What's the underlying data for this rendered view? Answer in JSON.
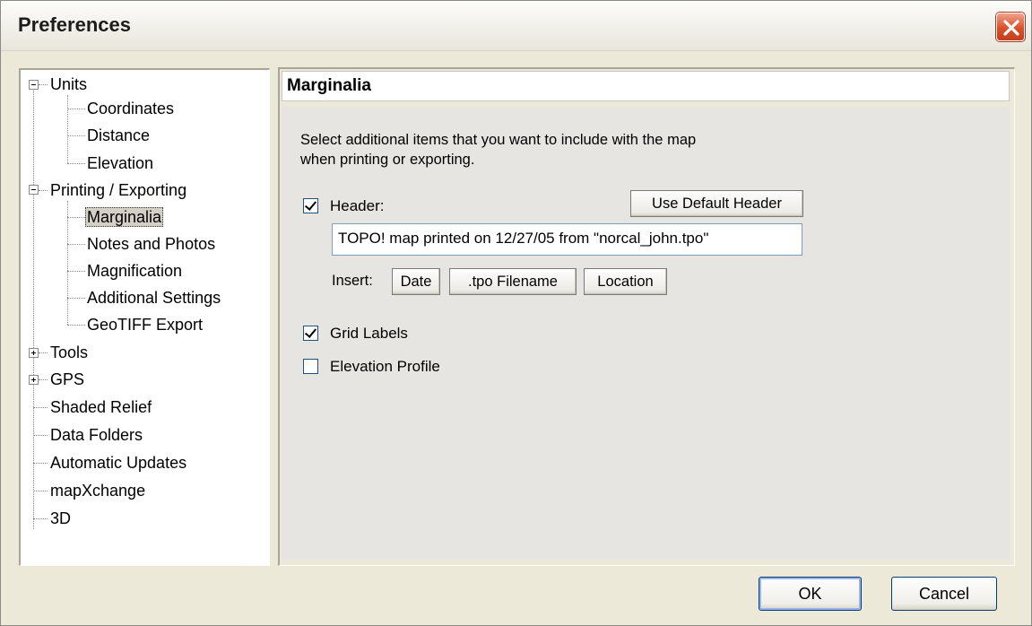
{
  "window": {
    "title": "Preferences"
  },
  "tree": {
    "units": "Units",
    "coordinates": "Coordinates",
    "distance": "Distance",
    "elevation": "Elevation",
    "printing": "Printing / Exporting",
    "marginalia": "Marginalia",
    "notes": "Notes and Photos",
    "magnification": "Magnification",
    "additional": "Additional Settings",
    "geotiff": "GeoTIFF Export",
    "tools": "Tools",
    "gps": "GPS",
    "shaded": "Shaded Relief",
    "datafolders": "Data Folders",
    "updates": "Automatic Updates",
    "mapxchange": "mapXchange",
    "threed": "3D"
  },
  "panel": {
    "title": "Marginalia",
    "description_line1": "Select additional items that you want to include with the map",
    "description_line2": "when printing or exporting.",
    "header_label": "Header:",
    "header_checked": true,
    "use_default_header": "Use Default Header",
    "header_value": "TOPO! map printed on 12/27/05 from \"norcal_john.tpo\"",
    "insert_label": "Insert:",
    "insert_date": "Date",
    "insert_filename": ".tpo Filename",
    "insert_location": "Location",
    "grid_labels_label": "Grid Labels",
    "grid_labels_checked": true,
    "elevation_profile_label": "Elevation Profile",
    "elevation_profile_checked": false
  },
  "footer": {
    "ok": "OK",
    "cancel": "Cancel"
  }
}
